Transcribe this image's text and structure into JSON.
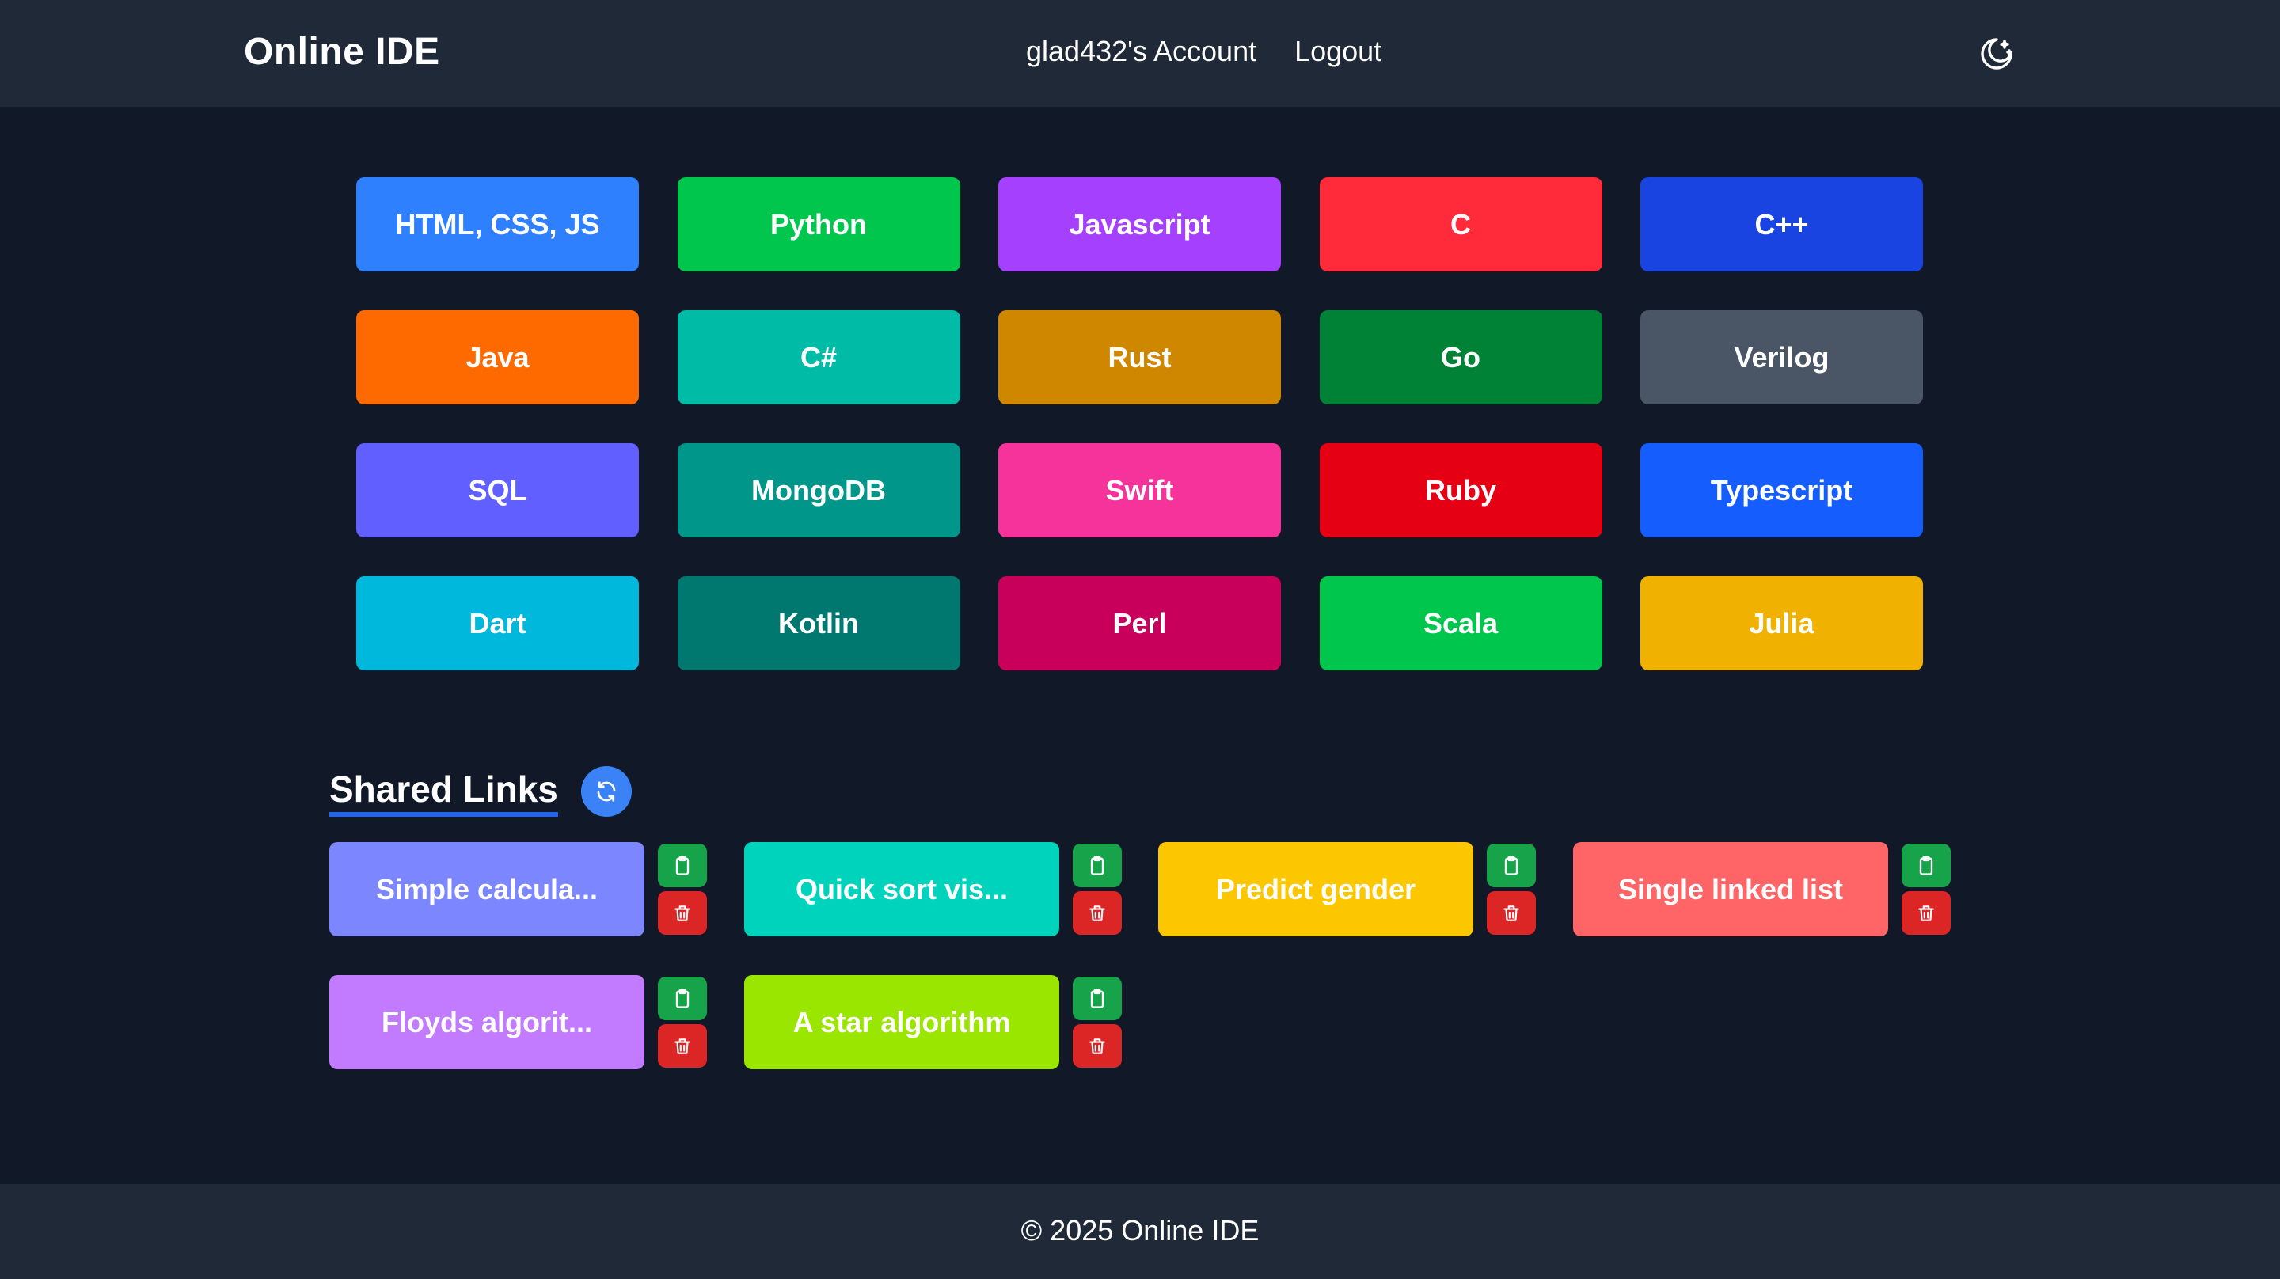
{
  "header": {
    "brand": "Online IDE",
    "account_link": "glad432's Account",
    "logout_link": "Logout",
    "theme_icon": "moon-stars-icon"
  },
  "languages": [
    {
      "label": "HTML, CSS, JS",
      "color": "#2f80ff"
    },
    {
      "label": "Python",
      "color": "#00c64d"
    },
    {
      "label": "Javascript",
      "color": "#a540ff"
    },
    {
      "label": "C",
      "color": "#ff2b3a"
    },
    {
      "label": "C++",
      "color": "#1a44e2"
    },
    {
      "label": "Java",
      "color": "#ff6a00"
    },
    {
      "label": "C#",
      "color": "#00bba6"
    },
    {
      "label": "Rust",
      "color": "#cf8700"
    },
    {
      "label": "Go",
      "color": "#008236"
    },
    {
      "label": "Verilog",
      "color": "#4a5565"
    },
    {
      "label": "SQL",
      "color": "#615fff"
    },
    {
      "label": "MongoDB",
      "color": "#009689"
    },
    {
      "label": "Swift",
      "color": "#f6339a"
    },
    {
      "label": "Ruby",
      "color": "#e60013"
    },
    {
      "label": "Typescript",
      "color": "#155dfc"
    },
    {
      "label": "Dart",
      "color": "#00b8db"
    },
    {
      "label": "Kotlin",
      "color": "#00786f"
    },
    {
      "label": "Perl",
      "color": "#c8005c"
    },
    {
      "label": "Scala",
      "color": "#00c64d"
    },
    {
      "label": "Julia",
      "color": "#f0b100"
    }
  ],
  "shared_links": {
    "title": "Shared Links",
    "refresh_icon": "refresh-icon",
    "items": [
      {
        "label": "Simple calcula...",
        "color": "#7c86ff"
      },
      {
        "label": "Quick sort vis...",
        "color": "#00d3bb"
      },
      {
        "label": "Predict gender",
        "color": "#fdc700"
      },
      {
        "label": "Single linked list",
        "color": "#ff6467"
      },
      {
        "label": "Floyds algorit...",
        "color": "#c27aff"
      },
      {
        "label": "A star algorithm",
        "color": "#9ae600"
      }
    ],
    "copy_icon": "clipboard-icon",
    "delete_icon": "trash-icon"
  },
  "footer": {
    "text": "© 2025 Online IDE"
  }
}
